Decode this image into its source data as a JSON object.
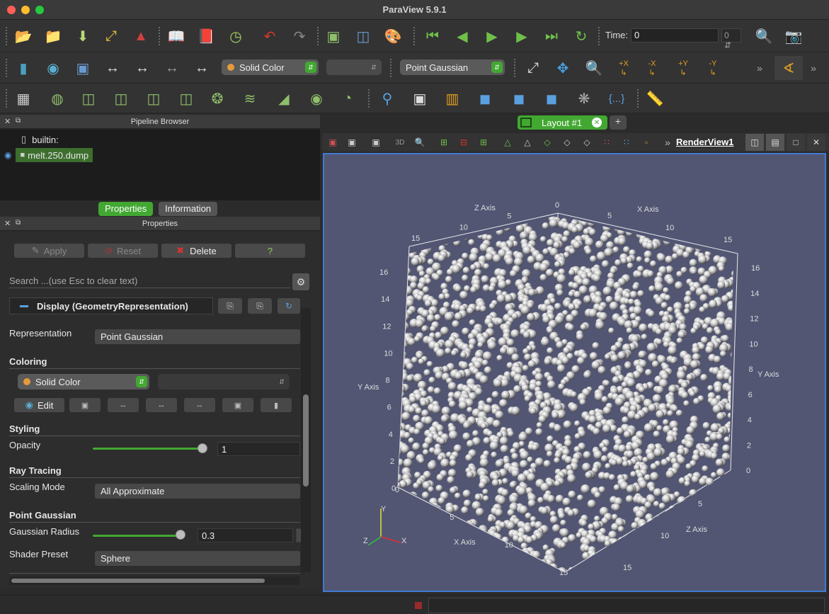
{
  "window": {
    "title": "ParaView 5.9.1"
  },
  "toolbar_main": {
    "time_label": "Time:",
    "time_value": "0",
    "time_step": "0"
  },
  "toolbar_vis": {
    "coloring_combo": "Solid Color",
    "representation_combo": "Point Gaussian",
    "camera_labels": {
      "px": "+X",
      "mx": "-X",
      "py": "+Y",
      "my": "-Y"
    }
  },
  "pipeline_browser": {
    "title": "Pipeline Browser",
    "items": [
      {
        "label": "builtin:"
      },
      {
        "label": "melt.250.dump"
      }
    ]
  },
  "panel_tabs": {
    "properties": "Properties",
    "information": "Information"
  },
  "properties": {
    "title": "Properties",
    "apply": "Apply",
    "reset": "Reset",
    "delete": "Delete",
    "help": "?",
    "search_placeholder": "Search ...(use Esc to clear text)",
    "display_section": "Display (GeometryRepresentation)",
    "representation_label": "Representation",
    "representation_value": "Point Gaussian",
    "coloring_group": "Coloring",
    "coloring_value": "Solid Color",
    "edit_label": "Edit",
    "styling_group": "Styling",
    "opacity_label": "Opacity",
    "opacity_value": "1",
    "raytracing_group": "Ray Tracing",
    "scaling_mode_label": "Scaling Mode",
    "scaling_mode_value": "All Approximate",
    "pointgaussian_group": "Point Gaussian",
    "gaussian_radius_label": "Gaussian Radius",
    "gaussian_radius_value": "0.3",
    "shader_preset_label": "Shader Preset",
    "shader_preset_value": "Sphere"
  },
  "layout": {
    "tab_label": "Layout #1",
    "view_3d_label": "3D",
    "render_view_name": "RenderView1"
  },
  "render_view": {
    "background": "#525673",
    "axis_titles": {
      "z_top": "Z Axis",
      "x_top": "X Axis",
      "y_left": "Y Axis",
      "y_right": "Y Axis",
      "x_bottom": "X Axis",
      "z_bottom": "Z Axis"
    },
    "top_left_ticks": [
      "15",
      "10",
      "5",
      "0"
    ],
    "top_right_ticks": [
      "5",
      "10",
      "15"
    ],
    "left_ticks": [
      "16",
      "14",
      "12",
      "10",
      "8",
      "6",
      "4",
      "2",
      "0"
    ],
    "right_ticks": [
      "16",
      "14",
      "12",
      "10",
      "8",
      "6",
      "4",
      "2",
      "0"
    ],
    "bottom_x_ticks": [
      "0",
      "5",
      "10",
      "15"
    ],
    "bottom_z_ticks": [
      "5",
      "10",
      "15"
    ],
    "orientation_labels": {
      "y": "Y",
      "z": "Z",
      "x": "X"
    }
  }
}
